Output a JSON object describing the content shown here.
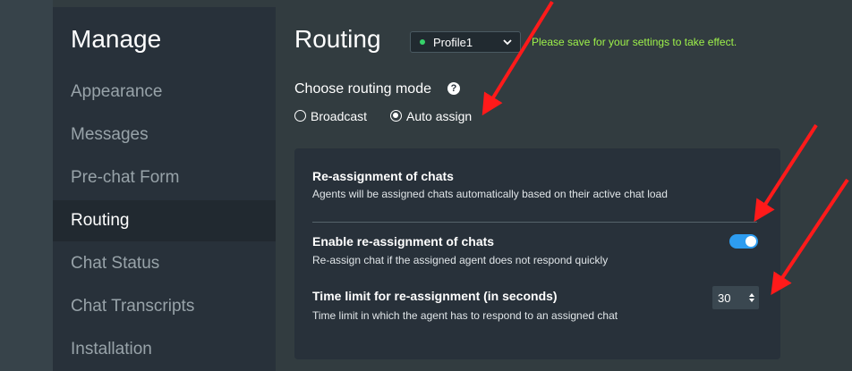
{
  "sidebar": {
    "title": "Manage",
    "items": [
      {
        "label": "Appearance"
      },
      {
        "label": "Messages"
      },
      {
        "label": "Pre-chat Form"
      },
      {
        "label": "Routing"
      },
      {
        "label": "Chat Status"
      },
      {
        "label": "Chat Transcripts"
      },
      {
        "label": "Installation"
      }
    ],
    "active_item": "Routing"
  },
  "header": {
    "title": "Routing",
    "profile_select": {
      "value": "Profile1",
      "status_color": "#36d26a"
    },
    "save_note": "Please save for your settings to take effect."
  },
  "routing_mode": {
    "label": "Choose routing mode",
    "help_icon": "question-circle-icon",
    "options": [
      {
        "label": "Broadcast",
        "selected": false
      },
      {
        "label": "Auto assign",
        "selected": true
      }
    ]
  },
  "panel": {
    "reassignment": {
      "title": "Re-assignment of chats",
      "description": "Agents will be assigned chats automatically based on their active chat load"
    },
    "enable": {
      "title": "Enable re-assignment of chats",
      "description": "Re-assign chat if the assigned agent does not respond quickly",
      "enabled": true
    },
    "time_limit": {
      "title": "Time limit for re-assignment (in seconds)",
      "description": "Time limit in which the agent has to respond to an assigned chat",
      "value": "30"
    }
  },
  "colors": {
    "accent": "#2d9cf0",
    "save_note": "#9ef24a",
    "annotation_arrow": "#ff1a1a"
  }
}
